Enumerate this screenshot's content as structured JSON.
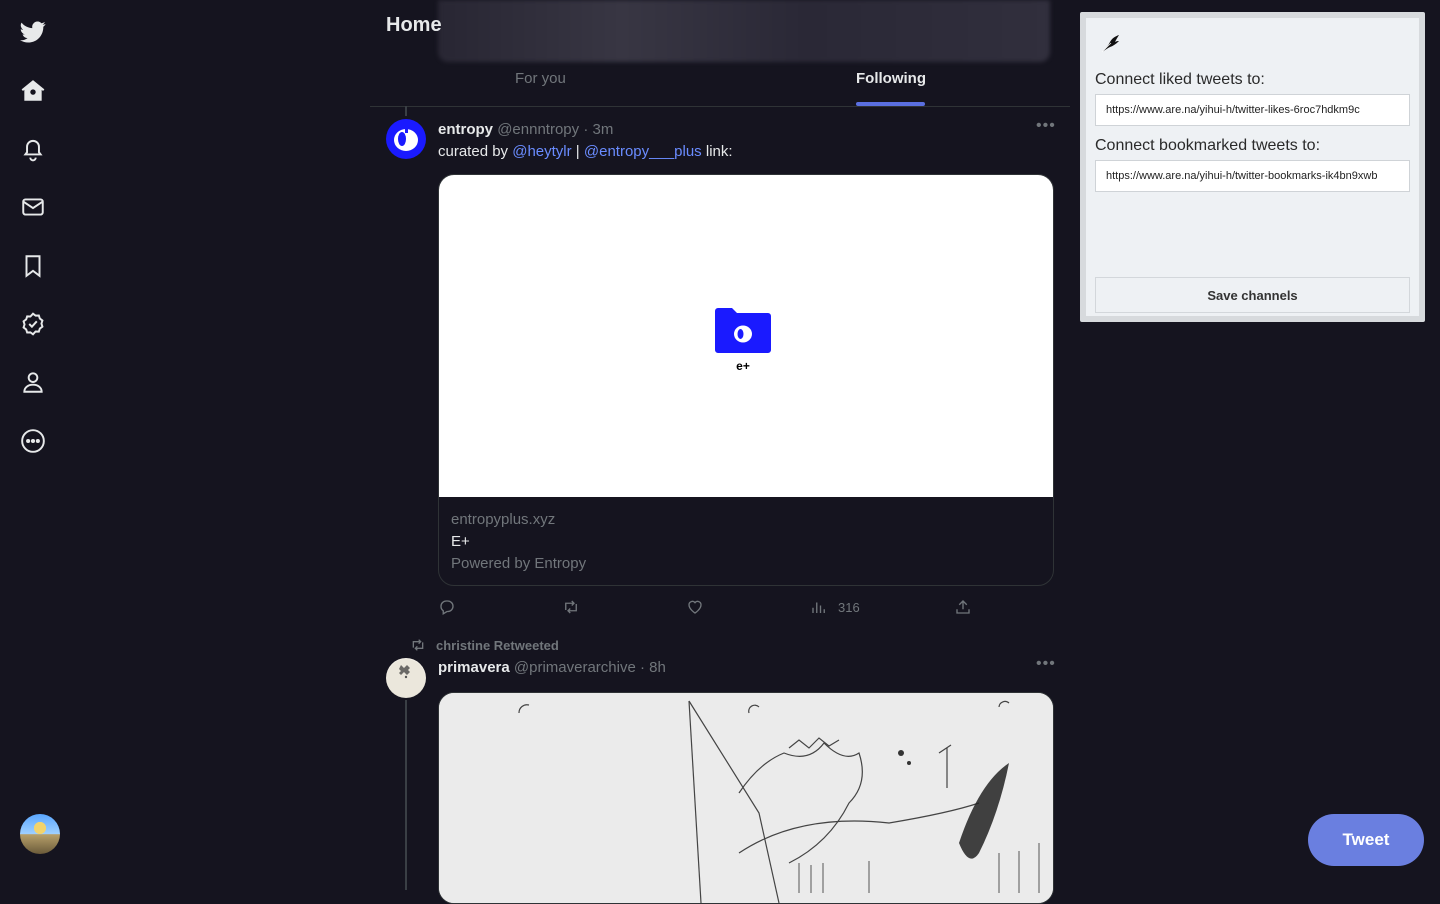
{
  "header": {
    "title": "Home"
  },
  "tabs": [
    {
      "label": "For you"
    },
    {
      "label": "Following"
    }
  ],
  "tweet1": {
    "name": "entropy",
    "handle": "@ennntropy",
    "time": "· 3m",
    "text_prefix": "curated by ",
    "mention1": "@heytylr",
    "separator": " | ",
    "mention2": "@entropy___plus",
    "text_suffix": " link:",
    "card": {
      "logo_text": "e+",
      "domain": "entropyplus.xyz",
      "title": "E+",
      "description": "Powered by Entropy"
    },
    "actions": {
      "views": "316"
    }
  },
  "retweet": {
    "label": "christine Retweeted"
  },
  "tweet2": {
    "name": "primavera",
    "handle": "@primaverarchive",
    "time": "· 8h"
  },
  "extension": {
    "liked_label": "Connect liked tweets to:",
    "liked_value": "https://www.are.na/yihui-h/twitter-likes-6roc7hdkm9c",
    "bookmarked_label": "Connect bookmarked tweets to:",
    "bookmarked_value": "https://www.are.na/yihui-h/twitter-bookmarks-ik4bn9xwb",
    "save_label": "Save channels"
  },
  "compose": {
    "tweet_label": "Tweet"
  },
  "colors": {
    "background": "#15141f",
    "accent": "#6a7fe0",
    "link": "#6a8cff",
    "muted": "#71767b"
  }
}
